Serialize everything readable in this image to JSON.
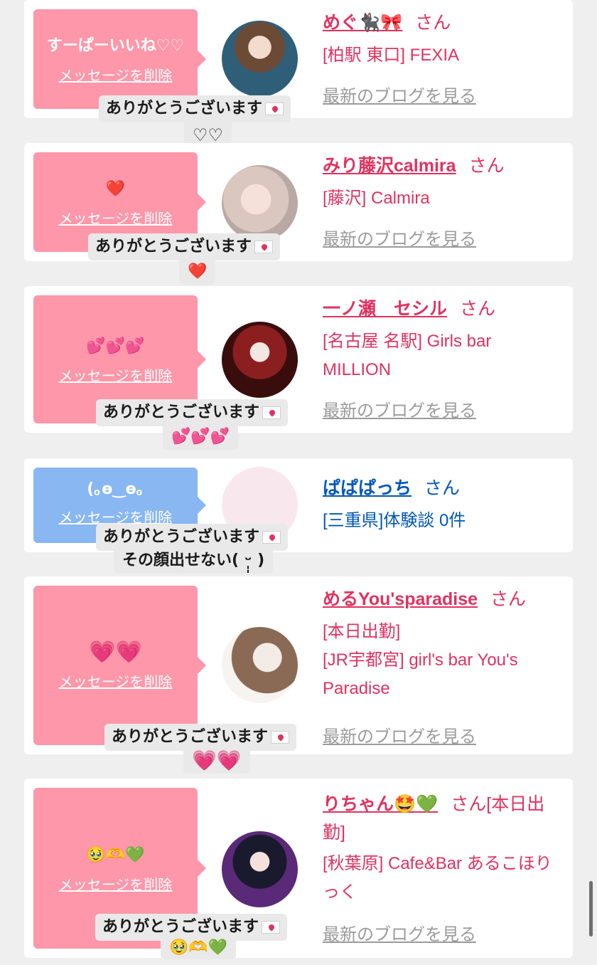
{
  "common": {
    "delete_label": "メッセージを削除",
    "blog_label": "最新のブログを見る",
    "san_label": "さん",
    "thanks_label": "ありがとうございます"
  },
  "items": [
    {
      "bubble_text": "すーぱーいいね♡♡",
      "name": "めぐ🐈‍⬛🎀",
      "shop": "[柏駅 東口] FEXIA",
      "reply_line2": "♡♡"
    },
    {
      "bubble_text": "❤️",
      "name": "みり藤沢calmira",
      "shop": "[藤沢] Calmira",
      "reply_line2": "❤️"
    },
    {
      "bubble_text": "💕💕💕",
      "name": "一ノ瀬　セシル",
      "shop": "[名古屋 名駅] Girls bar MILLION",
      "reply_line2": "💕💕💕"
    },
    {
      "bubble_text": "(｡ө‿ө｡",
      "name": "ぱぱぱっち",
      "shop": "[三重県]体験談 0件",
      "reply_line2": "その顔出せない( ᵕ̩̩ )"
    },
    {
      "bubble_text": "💗💗",
      "name": "めるYou'sparadise",
      "status": "[本日出勤]",
      "shop": "[JR宇都宮] girl's bar You's Paradise",
      "reply_line2": "💗💗"
    },
    {
      "bubble_text": "🥹🫶💚",
      "name": "りちゃん🤩💚",
      "status": "[本日出勤]",
      "shop": "[秋葉原] Cafe&Bar あるこほりっく",
      "reply_line2": "🥹🫶💚"
    }
  ],
  "colors": {
    "pink_bubble": "#fe97a9",
    "blue_bubble": "#88b7f2",
    "name_pink": "#e1325f",
    "name_blue": "#0057b8",
    "background": "#efefef"
  }
}
